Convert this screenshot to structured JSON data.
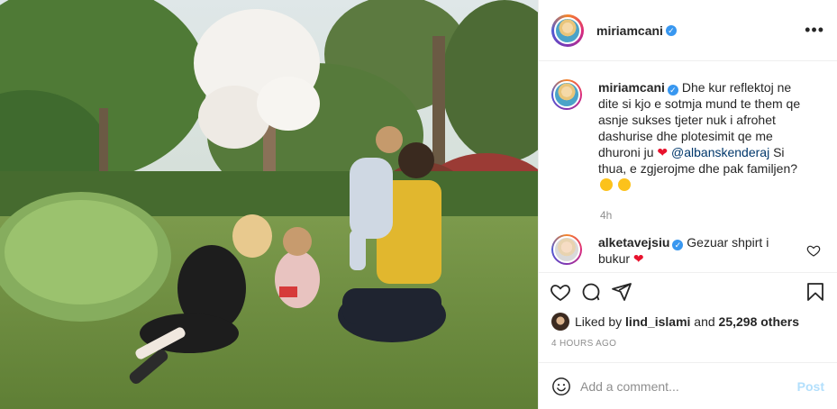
{
  "header": {
    "username": "miriamcani",
    "more_label": "•••"
  },
  "caption": {
    "username": "miriamcani",
    "text_part1": "Dhe kur reflektoj ne dite si kjo e sotmja mund te them qe asnje sukses tjeter nuk i afrohet dashurise dhe plotesimit qe me dhuroni ju",
    "mention": "@albanskenderaj",
    "text_part2": "Si thua, e zgjerojme dhe pak familjen?",
    "time": "4h"
  },
  "comments": [
    {
      "username": "alketavejsiu",
      "text": "Gezuar shpirt i bukur"
    }
  ],
  "likes": {
    "prefix": "Liked by",
    "first_liker": "lind_islami",
    "and": "and",
    "others": "25,298 others"
  },
  "timestamp": "4 HOURS AGO",
  "add_comment": {
    "placeholder": "Add a comment...",
    "post_label": "Post"
  },
  "icons": {
    "verified": "verified-badge-icon",
    "like": "heart-icon",
    "comment": "comment-bubble-icon",
    "share": "paper-plane-icon",
    "save": "bookmark-icon",
    "emoji": "smiley-icon"
  },
  "colors": {
    "verified": "#3897f0",
    "heart": "#e8122d",
    "post_disabled": "#b2dffc",
    "muted": "#8e8e8e"
  }
}
